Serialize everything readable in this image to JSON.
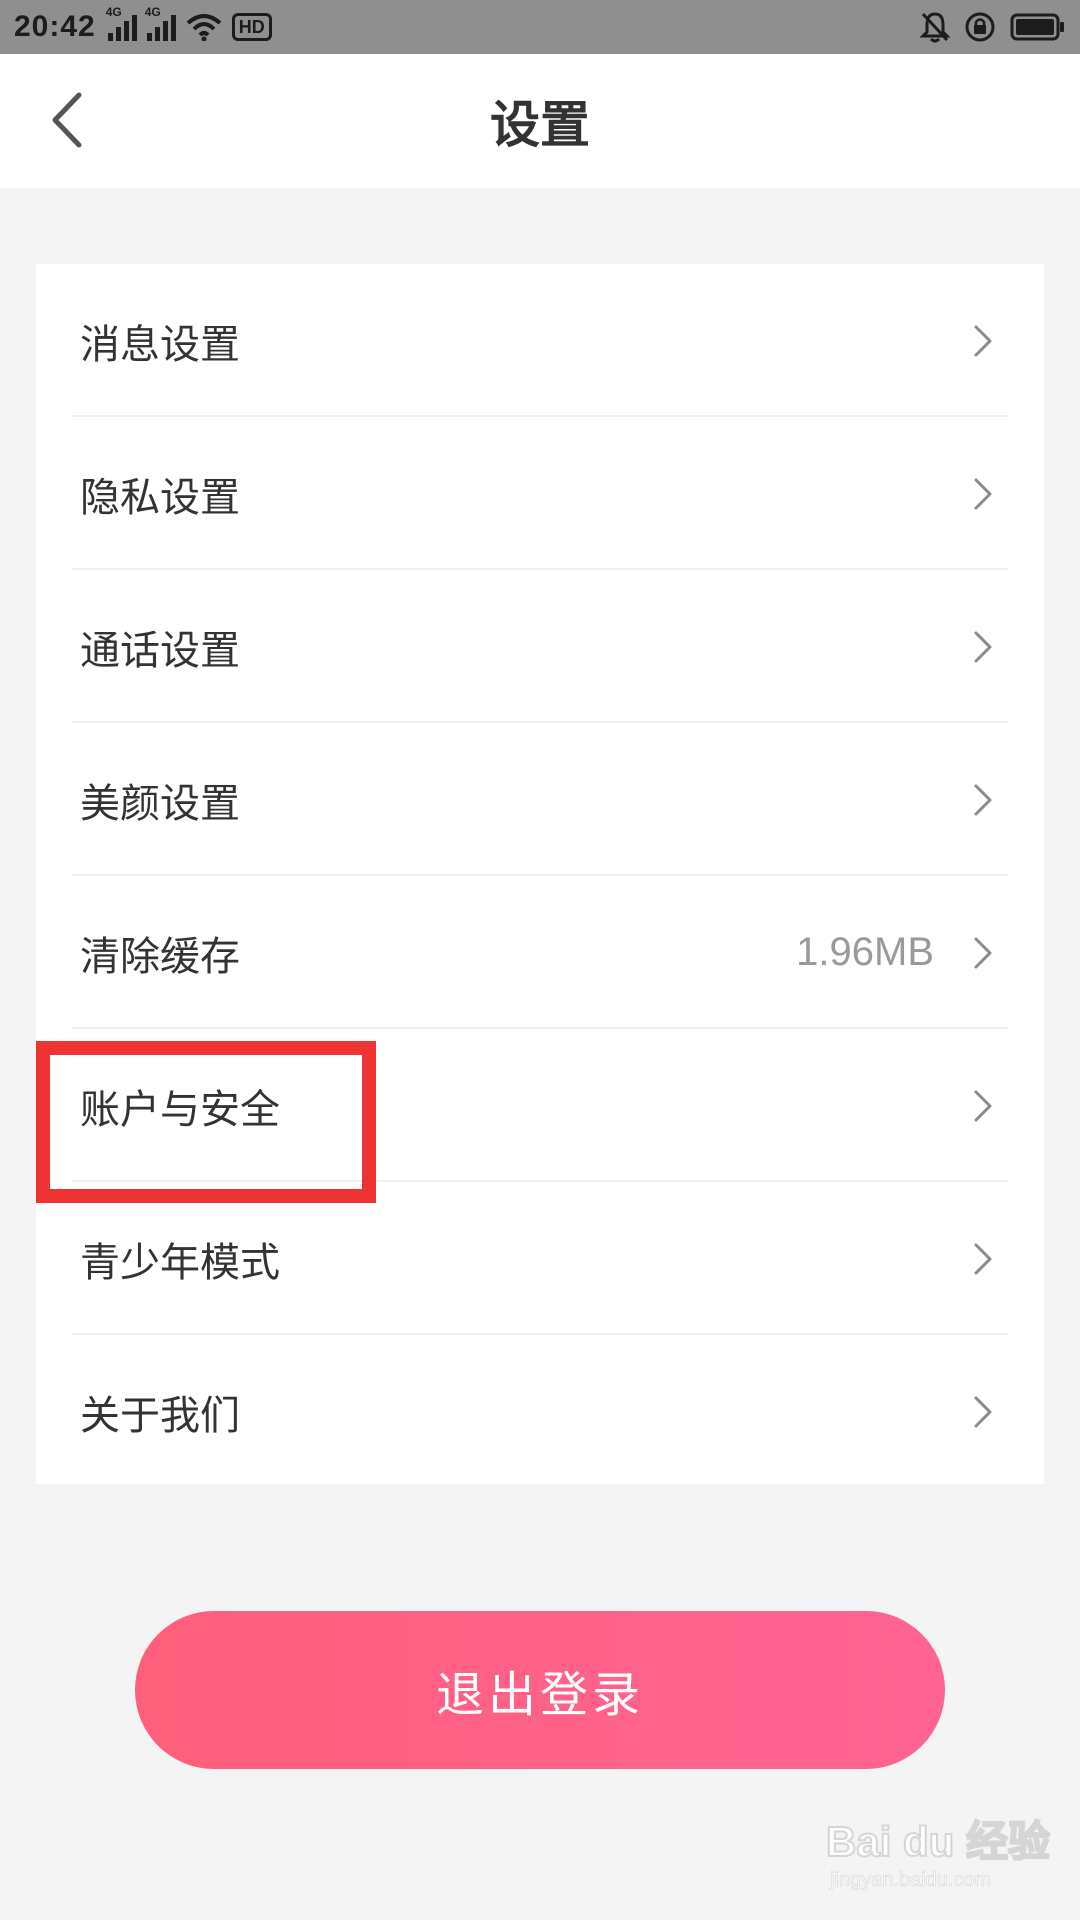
{
  "status_bar": {
    "time": "20:42",
    "signal_labels": [
      "4G",
      "4G"
    ],
    "hd_label": "HD",
    "icons": [
      "signal-icon",
      "signal-icon",
      "wifi-icon",
      "hd-icon",
      "bell-muted-icon",
      "rotation-lock-icon",
      "battery-icon"
    ]
  },
  "nav": {
    "title": "设置",
    "back_icon": "chevron-left-icon"
  },
  "settings": {
    "items": [
      {
        "label": "消息设置"
      },
      {
        "label": "隐私设置"
      },
      {
        "label": "通话设置"
      },
      {
        "label": "美颜设置"
      },
      {
        "label": "清除缓存",
        "value": "1.96MB"
      },
      {
        "label": "账户与安全"
      },
      {
        "label": "青少年模式"
      },
      {
        "label": "关于我们"
      }
    ],
    "row_icon": "chevron-right-icon"
  },
  "logout": {
    "label": "退出登录"
  },
  "watermark": {
    "logo_text": "Bai du 经验",
    "sub_text": "jingyan.baidu.com"
  },
  "colors": {
    "accent": "#ff6188",
    "highlight": "#ee3333",
    "background": "#f4f4f4"
  }
}
